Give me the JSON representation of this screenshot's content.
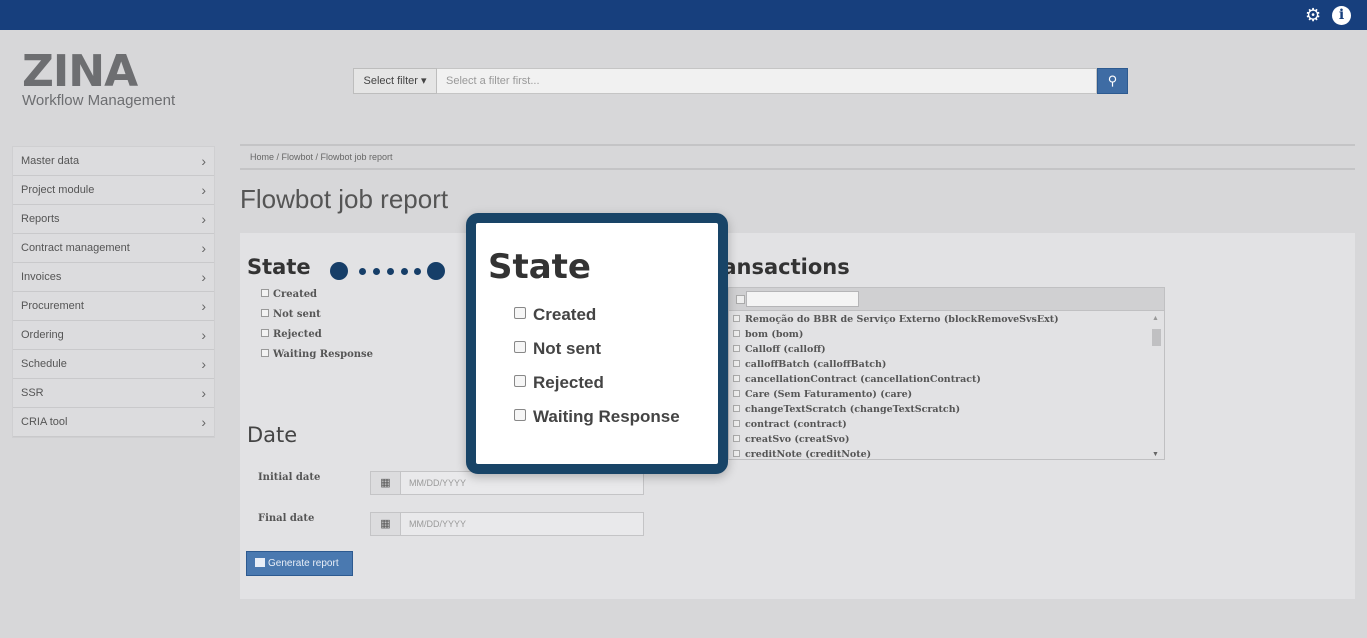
{
  "header": {
    "settings_icon": "gear-icon",
    "info_icon": "info-icon"
  },
  "logo": {
    "name": "ZINA",
    "tagline": "Workflow Management"
  },
  "filter": {
    "select_label": "Select filter ▾",
    "placeholder": "Select a filter first...",
    "search_icon": "search-icon"
  },
  "sidebar": {
    "items": [
      {
        "label": "Master data"
      },
      {
        "label": "Project module"
      },
      {
        "label": "Reports"
      },
      {
        "label": "Contract management"
      },
      {
        "label": "Invoices"
      },
      {
        "label": "Procurement"
      },
      {
        "label": "Ordering"
      },
      {
        "label": "Schedule"
      },
      {
        "label": "SSR"
      },
      {
        "label": "CRIA tool"
      }
    ]
  },
  "breadcrumb": "Home  /  Flowbot  /  Flowbot job report",
  "page_title": "Flowbot job report",
  "state": {
    "title": "State",
    "options": [
      "Created",
      "Not sent",
      "Rejected",
      "Waiting Response"
    ]
  },
  "date": {
    "title": "Date",
    "initial_label": "Initial date",
    "final_label": "Final date",
    "placeholder": "MM/DD/YYYY"
  },
  "generate_button": "Generate report",
  "transactions": {
    "title": "ransactions",
    "items": [
      "Remoção do BBR de Serviço Externo (blockRemoveSvsExt)",
      "bom (bom)",
      "Calloff (calloff)",
      "calloffBatch (calloffBatch)",
      "cancellationContract (cancellationContract)",
      "Care (Sem Faturamento) (care)",
      "changeTextScratch (changeTextScratch)",
      "contract (contract)",
      "creatSvo (creatSvo)",
      "creditNote (creditNote)"
    ]
  },
  "zoom_callout": {
    "title": "State",
    "options": [
      "Created",
      "Not sent",
      "Rejected",
      "Waiting Response"
    ]
  }
}
